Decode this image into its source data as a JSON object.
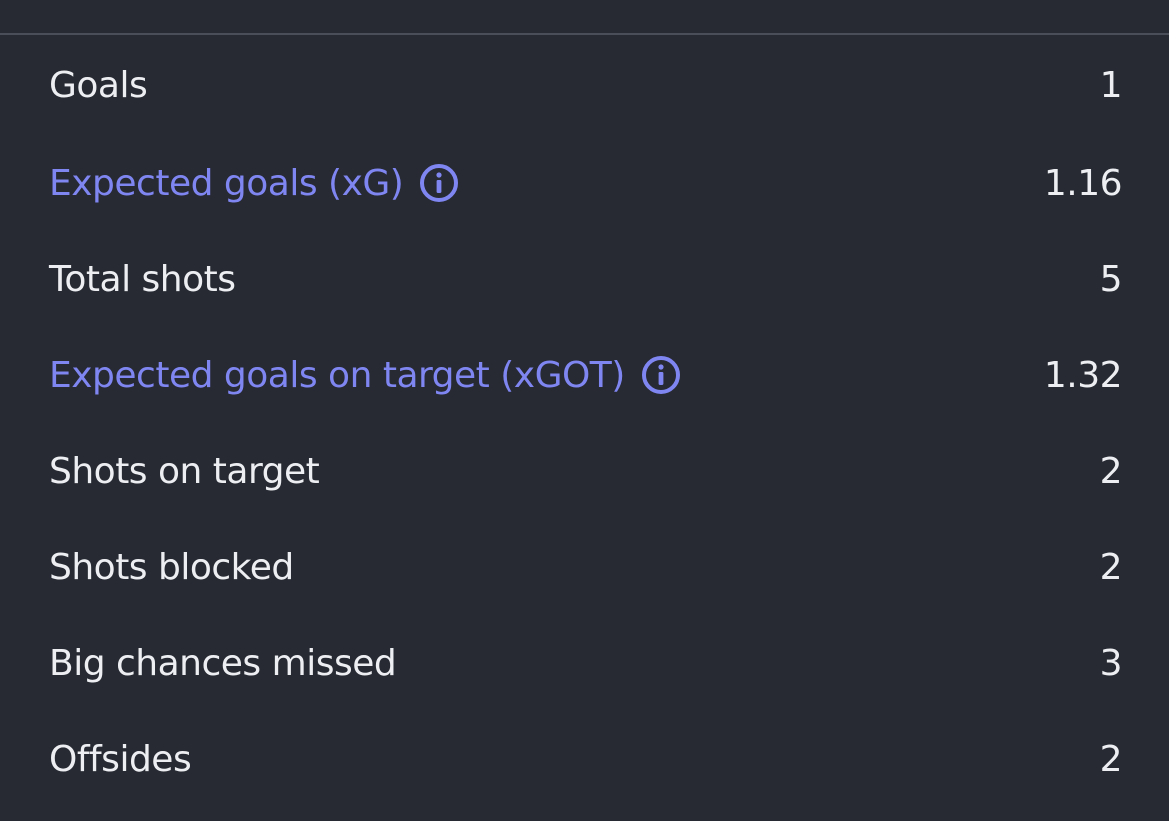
{
  "stats": [
    {
      "label": "Goals",
      "value": "1",
      "link": false
    },
    {
      "label": "Expected goals (xG)",
      "value": "1.16",
      "link": true
    },
    {
      "label": "Total shots",
      "value": "5",
      "link": false
    },
    {
      "label": "Expected goals on target (xGOT)",
      "value": "1.32",
      "link": true
    },
    {
      "label": "Shots on target",
      "value": "2",
      "link": false
    },
    {
      "label": "Shots blocked",
      "value": "2",
      "link": false
    },
    {
      "label": "Big chances missed",
      "value": "3",
      "link": false
    },
    {
      "label": "Offsides",
      "value": "2",
      "link": false
    }
  ],
  "colors": {
    "background": "#272a32",
    "text": "#eceef2",
    "accent": "#7f86f2",
    "divider": "#4a4e58"
  },
  "icons": {
    "info": "info-icon"
  }
}
